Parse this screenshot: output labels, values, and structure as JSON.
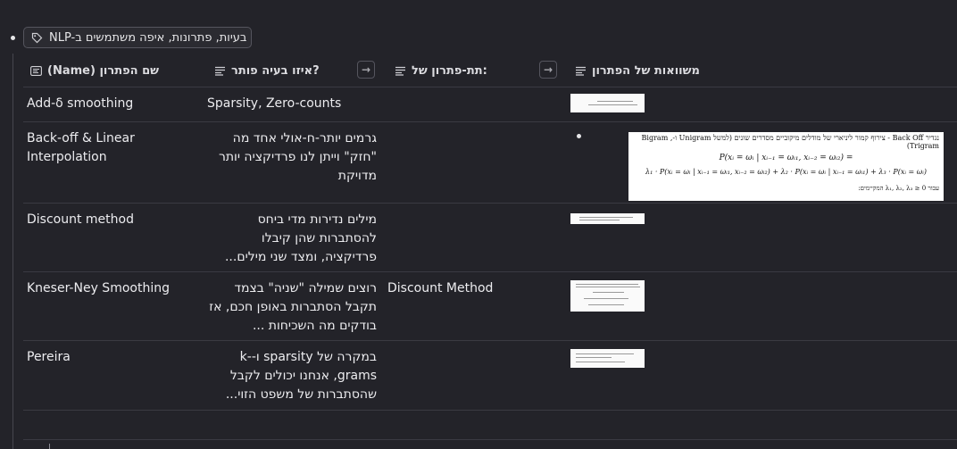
{
  "tag": {
    "label": "NLP-בעיות, פתרונות, איפה משתמשים ב"
  },
  "headers": {
    "name": "(Name) שם הפתרון",
    "problem": "איזו בעיה פותר?",
    "subsolution": "תת-פתרון של:",
    "equations": "משוואות של הפתרון"
  },
  "rows": [
    {
      "name": "Add-δ smoothing",
      "problem": "Sparsity, Zero-counts",
      "sub": ""
    },
    {
      "name": "Back-off & Linear Interpolation",
      "problem": "גרמים יותר-ח-אולי אחד מה \"חזק\" וייתן לנו פרדיקציה יותר מדויקת",
      "sub": ""
    },
    {
      "name": "Discount method",
      "problem": "מילים נדירות מדי ביחס להסתברות שהן קיבלו פרדיקציה, ומצד שני מילים...",
      "sub": ""
    },
    {
      "name": "Kneser-Ney Smoothing",
      "problem": "רוצים שמילה \"שניה\" בצמד תקבל הסתברות באופן חכם, אז בודקים מה השכיחות ...",
      "sub": "Discount Method"
    },
    {
      "name": "Pereira",
      "problem": "במקרה של sparsity ו-k-grams, אנחנו יכולים לקבל שהסתברות של משפט הזוי...",
      "sub": ""
    }
  ],
  "formula": {
    "line1": "נגדיר Back Off - צירוף קמור ליניארי של מודלים מיקוביים מסדרים שונים (למשל Unigram ו-Bigram , Trigram)",
    "line2": "P(xᵢ = ωᵢ | xᵢ₋₁ = ωᵢ₁, xᵢ₋₂ = ωᵢ₂) =",
    "line3": "λ₁ · P(xᵢ = ωᵢ | xᵢ₋₁ = ωᵢ₁, xᵢ₋₂ = ωᵢ₂) + λ₂ · P(xᵢ = ωᵢ | xᵢ₋₁ = ωᵢ₁) + λ₃ · P(xᵢ = ωᵢ)",
    "line4": "עבור λ₁, λ₂, λ₃ ≥ 0 המקיימים:"
  },
  "colors": {
    "background": "#232329",
    "text": "#e6e6e8",
    "border": "#3a3a42"
  },
  "icons": {
    "tag": "tag-icon",
    "name_column": "title-property-icon",
    "text_columns": "text-lines-icon",
    "relation": "arrow-right-icon"
  }
}
